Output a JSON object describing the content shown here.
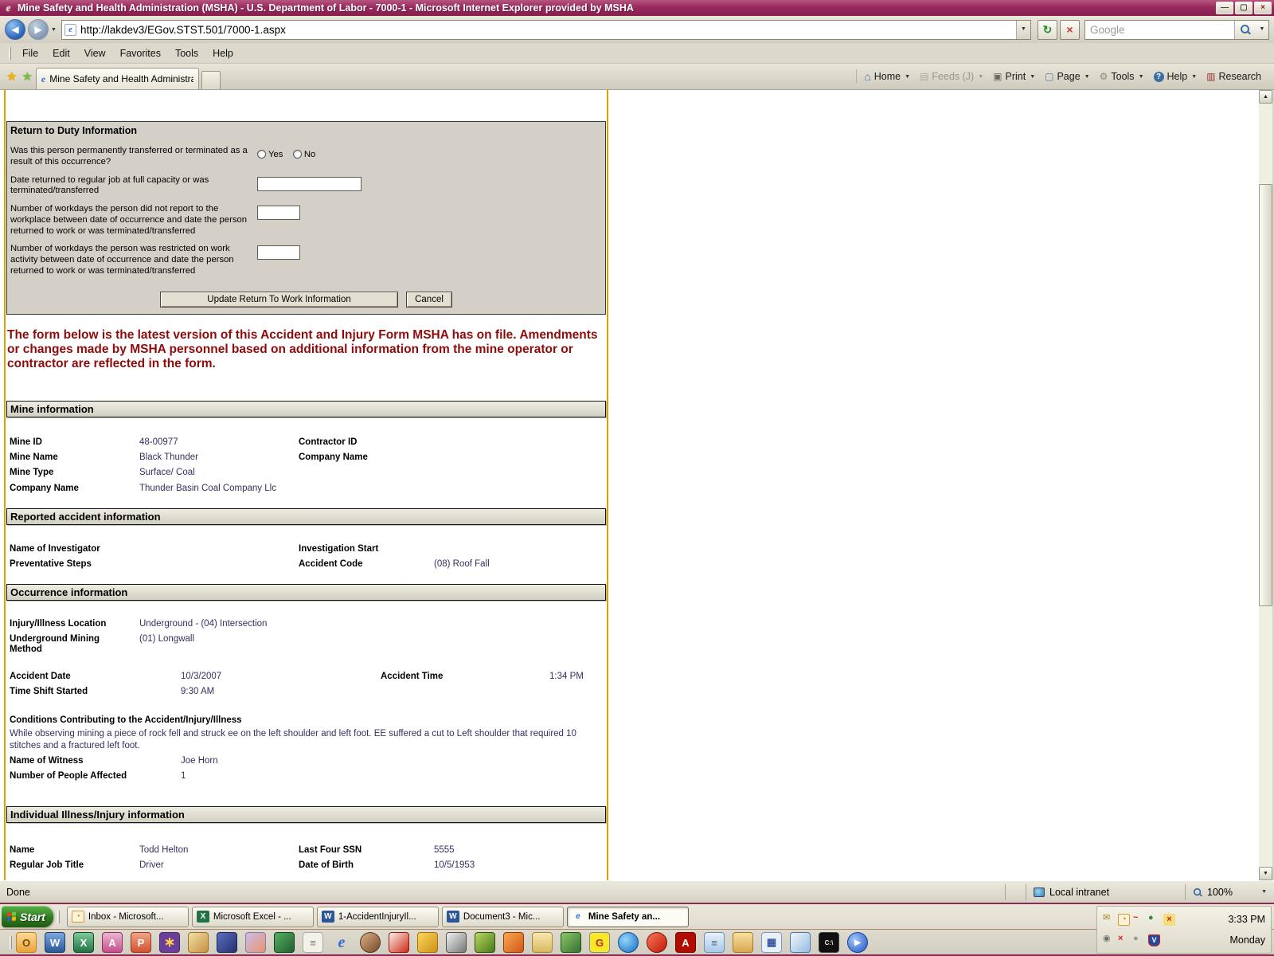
{
  "window": {
    "title": "Mine Safety and Health Administration (MSHA) - U.S. Department of Labor - 7000-1 - Microsoft Internet Explorer provided by MSHA",
    "url": "http://lakdev3/EGov.STST.501/7000-1.aspx",
    "search_placeholder": "Google",
    "tab_title": "Mine Safety and Health Administration ...",
    "status": "Done",
    "zone": "Local intranet",
    "zoom_level": "100%"
  },
  "icons": {
    "ie_logo": "e",
    "back": "◀",
    "forward": "▶",
    "caret_down": "▼",
    "refresh": "↻",
    "stop": "×",
    "star": "★",
    "add_star": "★",
    "home": "⌂",
    "feeds": "▤",
    "print": "▣",
    "page": "▢",
    "tools": "⚙",
    "help": "?",
    "research": "▥",
    "minimize": "—",
    "maximize": "▢",
    "close": "×",
    "scroll_up": "▲",
    "scroll_down": "▼"
  },
  "menu": {
    "items": [
      "File",
      "Edit",
      "View",
      "Favorites",
      "Tools",
      "Help"
    ]
  },
  "commandbar": {
    "home": "Home",
    "feeds": "Feeds (J)",
    "print": "Print",
    "page": "Page",
    "tools": "Tools",
    "help": "Help",
    "research": "Research"
  },
  "form": {
    "return_to_duty": {
      "title": "Return to Duty Information",
      "q_transferred": "Was this person permanently transferred or terminated as a result of this occurrence?",
      "radio_yes": "Yes",
      "radio_no": "No",
      "q_date_returned": "Date returned to regular job at full capacity or was terminated/transferred",
      "q_workdays_lost": "Number of workdays the person did not report to the workplace between date of occurrence and date the person returned to work or was terminated/transferred",
      "q_workdays_restricted": "Number of workdays the person was restricted on work activity between date of occurrence and date the person returned to work or was terminated/transferred",
      "update_button": "Update Return To Work Information",
      "cancel_button": "Cancel"
    },
    "notice": "The form below is the latest version of this Accident and Injury Form MSHA has on file. Amendments or changes made by MSHA personnel based on additional information from the mine operator or contractor are reflected in the form.",
    "mine": {
      "title": "Mine information",
      "rows": [
        [
          "Mine ID",
          "48-00977",
          "Contractor ID",
          ""
        ],
        [
          "Mine Name",
          "Black Thunder",
          "Company Name",
          ""
        ],
        [
          "Mine Type",
          "Surface/ Coal",
          "",
          ""
        ],
        [
          "Company Name",
          "Thunder Basin Coal Company Llc",
          "",
          ""
        ]
      ]
    },
    "reported": {
      "title": "Reported accident information",
      "rows": [
        [
          "Name of Investigator",
          "",
          "Investigation Start",
          ""
        ],
        [
          "Preventative Steps",
          "",
          "Accident Code",
          "(08) Roof Fall"
        ]
      ]
    },
    "occurrence": {
      "title": "Occurrence information",
      "loc_rows": [
        [
          "Injury/Illness Location",
          "Underground - (04) Intersection"
        ],
        [
          "Underground Mining Method",
          "(01) Longwall"
        ]
      ],
      "time_rows": [
        [
          "Accident Date",
          "10/3/2007",
          "Accident Time",
          "1:34 PM"
        ],
        [
          "Time Shift Started",
          "9:30 AM",
          "",
          ""
        ]
      ],
      "conditions_title": "Conditions Contributing to the Accident/Injury/Illness",
      "conditions_text": "While observing mining a piece of rock fell and struck ee on the left shoulder and left foot. EE suffered a cut to Left shoulder that required 10 stitches and a fractured left foot.",
      "witness_rows": [
        [
          "Name of Witness",
          "Joe Horn"
        ],
        [
          "Number of People Affected",
          "1"
        ]
      ]
    },
    "individual": {
      "title": "Individual Illness/Injury information",
      "rows": [
        [
          "Name",
          "Todd Helton",
          "Last Four SSN",
          "5555"
        ],
        [
          "Regular Job Title",
          "Driver",
          "Date of Birth",
          "10/5/1953"
        ]
      ]
    }
  },
  "taskbar": {
    "start_label": "Start",
    "tasks": [
      {
        "label": "Inbox - Microsoft...",
        "glyph": "◔",
        "name": "taskbar-button-outlook-inbox",
        "cls": "taskbtn",
        "style": "color:#c87818;background:#fdf3d8;border:1px solid #d89830;border-radius:2px;display:inline-flex;align-items:center;justify-content:center"
      },
      {
        "label": "Microsoft Excel - ...",
        "glyph": "X",
        "name": "taskbar-button-excel",
        "cls": "taskbtn",
        "style": "background:#217346;color:#fff;border-radius:2px;display:inline-flex;align-items:center;justify-content:center"
      },
      {
        "label": "1-AccidentInjuryIl...",
        "glyph": "W",
        "name": "taskbar-button-word-accident-injury",
        "cls": "taskbtn",
        "style": "background:#2b579a;color:#fff;border-radius:2px;display:inline-flex;align-items:center;justify-content:center"
      },
      {
        "label": "Document3 - Mic...",
        "glyph": "W",
        "name": "taskbar-button-word-document3",
        "cls": "taskbtn",
        "style": "background:#2b579a;color:#fff;border-radius:2px;display:inline-flex;align-items:center;justify-content:center"
      },
      {
        "label": "Mine Safety an...",
        "glyph": "e",
        "name": "taskbar-button-ie-mine-safety",
        "cls": "taskbtn active",
        "style": "color:#2f6fd6;font-style:italic;font-weight:bold;display:inline-flex;align-items:center;justify-content:center"
      }
    ],
    "tray_time": "3:33 PM",
    "tray_day": "Monday",
    "tray1": [
      {
        "glyph": "✉",
        "name": "mail-tray-icon",
        "style": "color:#a8881f"
      },
      {
        "glyph": "◔",
        "name": "clock-tray-icon",
        "style": "color:#c87818;background:#fdf3d8;border:1px solid #d89830;border-radius:2px;display:inline-flex;align-items:center;justify-content:center"
      },
      {
        "glyph": "~",
        "name": "signal-tray-icon",
        "style": "color:#d02020;font-weight:bold"
      },
      {
        "glyph": "●",
        "name": "spheres-tray-icon",
        "style": "color:#3a8a3a"
      },
      {
        "glyph": "×",
        "name": "key-disabled-tray-icon",
        "style": "color:#c02020;background:#f6dd7c;border-radius:2px;display:inline-flex;align-items:center;justify-content:center;font-weight:bold"
      }
    ],
    "tray2": [
      {
        "glyph": "◉",
        "name": "volume-tray-icon",
        "style": "color:#707070"
      },
      {
        "glyph": "×",
        "name": "error-x-tray-icon",
        "style": "color:#d02020;font-weight:bold"
      },
      {
        "glyph": "●",
        "name": "mouse-tray-icon",
        "style": "color:#9a9a9a"
      },
      {
        "glyph": "V",
        "name": "antivirus-shield-tray-icon",
        "style": "background:#2848a0;color:#fff;border:1px solid #c02020;border-radius:2px 2px 6px 6px;display:inline-flex;align-items:center;justify-content:center;font-size:9px;font-weight:bold"
      }
    ],
    "quicklaunch": [
      {
        "glyph": "O",
        "name": "outlook-quicklaunch-icon",
        "style": "background:linear-gradient(#fdd998,#e8a33c);color:#7a4a00;border:1px solid #c87f1e"
      },
      {
        "glyph": "W",
        "name": "word-quicklaunch-icon",
        "style": "background:linear-gradient(#7da7dd,#2b579a);color:#fff;border:1px solid #1b3a6b"
      },
      {
        "glyph": "X",
        "name": "excel-quicklaunch-icon",
        "style": "background:linear-gradient(#7dc99a,#217346);color:#fff;border:1px solid #14492c"
      },
      {
        "glyph": "A",
        "name": "access-key-quicklaunch-icon",
        "style": "background:linear-gradient(#eab7d2,#c84e8e);color:#fff;border:1px solid #8e2f62"
      },
      {
        "glyph": "P",
        "name": "powerpoint-quicklaunch-icon",
        "style": "background:linear-gradient(#f0a488,#d35230);color:#fff;border:1px solid #96351c"
      },
      {
        "glyph": "∗",
        "name": "pinwheel-quicklaunch-icon",
        "style": "background:#6a3f9a;color:#ffd24a;border:1px solid #472a6a;font-size:17px"
      },
      {
        "glyph": "",
        "name": "duck-character-quicklaunch-icon",
        "style": "background:linear-gradient(135deg,#f0e0a8,#c89040);border:1px solid #a07020"
      },
      {
        "glyph": "",
        "name": "crest-quicklaunch-icon",
        "style": "background:linear-gradient(135deg,#5a6ec0,#25306e);border:1px solid #1a2450"
      },
      {
        "glyph": "",
        "name": "bird-character-quicklaunch-icon",
        "style": "background:linear-gradient(135deg,#cabcec,#e8956a);border:1px solid #8a7ab0"
      },
      {
        "glyph": "",
        "name": "machine-character-quicklaunch-icon",
        "style": "background:linear-gradient(135deg,#56b060,#1f5f30);border:1px solid #154020"
      },
      {
        "glyph": "≡",
        "name": "newspaper-quicklaunch-icon",
        "style": "background:#f4f2e8;color:#777;border:1px solid #aaa"
      },
      {
        "glyph": "e",
        "name": "ie-quicklaunch-icon",
        "style": "color:#2f6fd6;font-style:italic;font-size:20px;font-family:'Liberation Serif',serif"
      },
      {
        "glyph": "",
        "name": "squirrel-character-quicklaunch-icon",
        "style": "background:linear-gradient(135deg,#d8b088,#7a4a28);border:1px solid #5a3418;border-radius:50%"
      },
      {
        "glyph": "",
        "name": "woodpecker-character-quicklaunch-icon",
        "style": "background:linear-gradient(135deg,#f8f0e8,#d02818);border:1px solid #901810"
      },
      {
        "glyph": "",
        "name": "giraffe-character-quicklaunch-icon",
        "style": "background:linear-gradient(135deg,#f8d858,#d09018);border:1px solid #a87010"
      },
      {
        "glyph": "",
        "name": "cat-character-quicklaunch-icon",
        "style": "background:linear-gradient(135deg,#f0f0f0,#787878);border:1px solid #505050"
      },
      {
        "glyph": "",
        "name": "grinch-character-quicklaunch-icon",
        "style": "background:linear-gradient(135deg,#b8d860,#4a7818);border:1px solid #305010"
      },
      {
        "glyph": "",
        "name": "tiger-character-quicklaunch-icon",
        "style": "background:linear-gradient(135deg,#f8a850,#d05818);border:1px solid #903808"
      },
      {
        "glyph": "",
        "name": "folder-search-quicklaunch-icon",
        "style": "background:linear-gradient(#f8e8b0,#d8b860);border:1px solid #a88830"
      },
      {
        "glyph": "",
        "name": "frog-chart-quicklaunch-icon",
        "style": "background:linear-gradient(135deg,#88c868,#387030);border:1px solid #205018"
      },
      {
        "glyph": "G",
        "name": "g-arrow-quicklaunch-icon",
        "style": "background:#f8e828;color:#c02818;border:1px solid #888"
      },
      {
        "glyph": "",
        "name": "globe-sync-quicklaunch-icon",
        "style": "background:radial-gradient(circle at 35% 35%,#90d8f8,#1868c8);border-radius:50%;border:1px solid #105090"
      },
      {
        "glyph": "",
        "name": "woodpecker2-character-quicklaunch-icon",
        "style": "background:linear-gradient(135deg,#f87858,#c01808);border:1px solid #801008;border-radius:50%"
      },
      {
        "glyph": "A",
        "name": "acrobat-quicklaunch-icon",
        "style": "background:#b30b00;color:#fff;border:1px solid #700800"
      },
      {
        "glyph": "≡",
        "name": "notepad-quicklaunch-icon",
        "style": "background:linear-gradient(#e8f0f8,#a8c8e8);color:#406888;border:1px solid #6890b8"
      },
      {
        "glyph": "",
        "name": "folder-magnifier-quicklaunch-icon",
        "style": "background:linear-gradient(#f8e0a0,#d8a850);border:1px solid #a87828"
      },
      {
        "glyph": "▦",
        "name": "reader-quicklaunch-icon",
        "style": "background:#e8f0f8;color:#3858a0;border:1px solid #8098c0"
      },
      {
        "glyph": "",
        "name": "document-edit-quicklaunch-icon",
        "style": "background:linear-gradient(135deg,#f0f6fc,#98bce0);border:1px solid #4878b0"
      },
      {
        "glyph": "C:\\",
        "name": "command-prompt-quicklaunch-icon",
        "style": "background:#101010;color:#e8e8e8;border:1px solid #404040;font-size:8px"
      },
      {
        "glyph": "▶",
        "name": "media-player-quicklaunch-icon",
        "style": "background:radial-gradient(circle at 35% 35%,#a0c8f8,#2050c0);color:#fff;border-radius:50%;border:1px solid #1840a0;font-size:10px"
      }
    ]
  }
}
